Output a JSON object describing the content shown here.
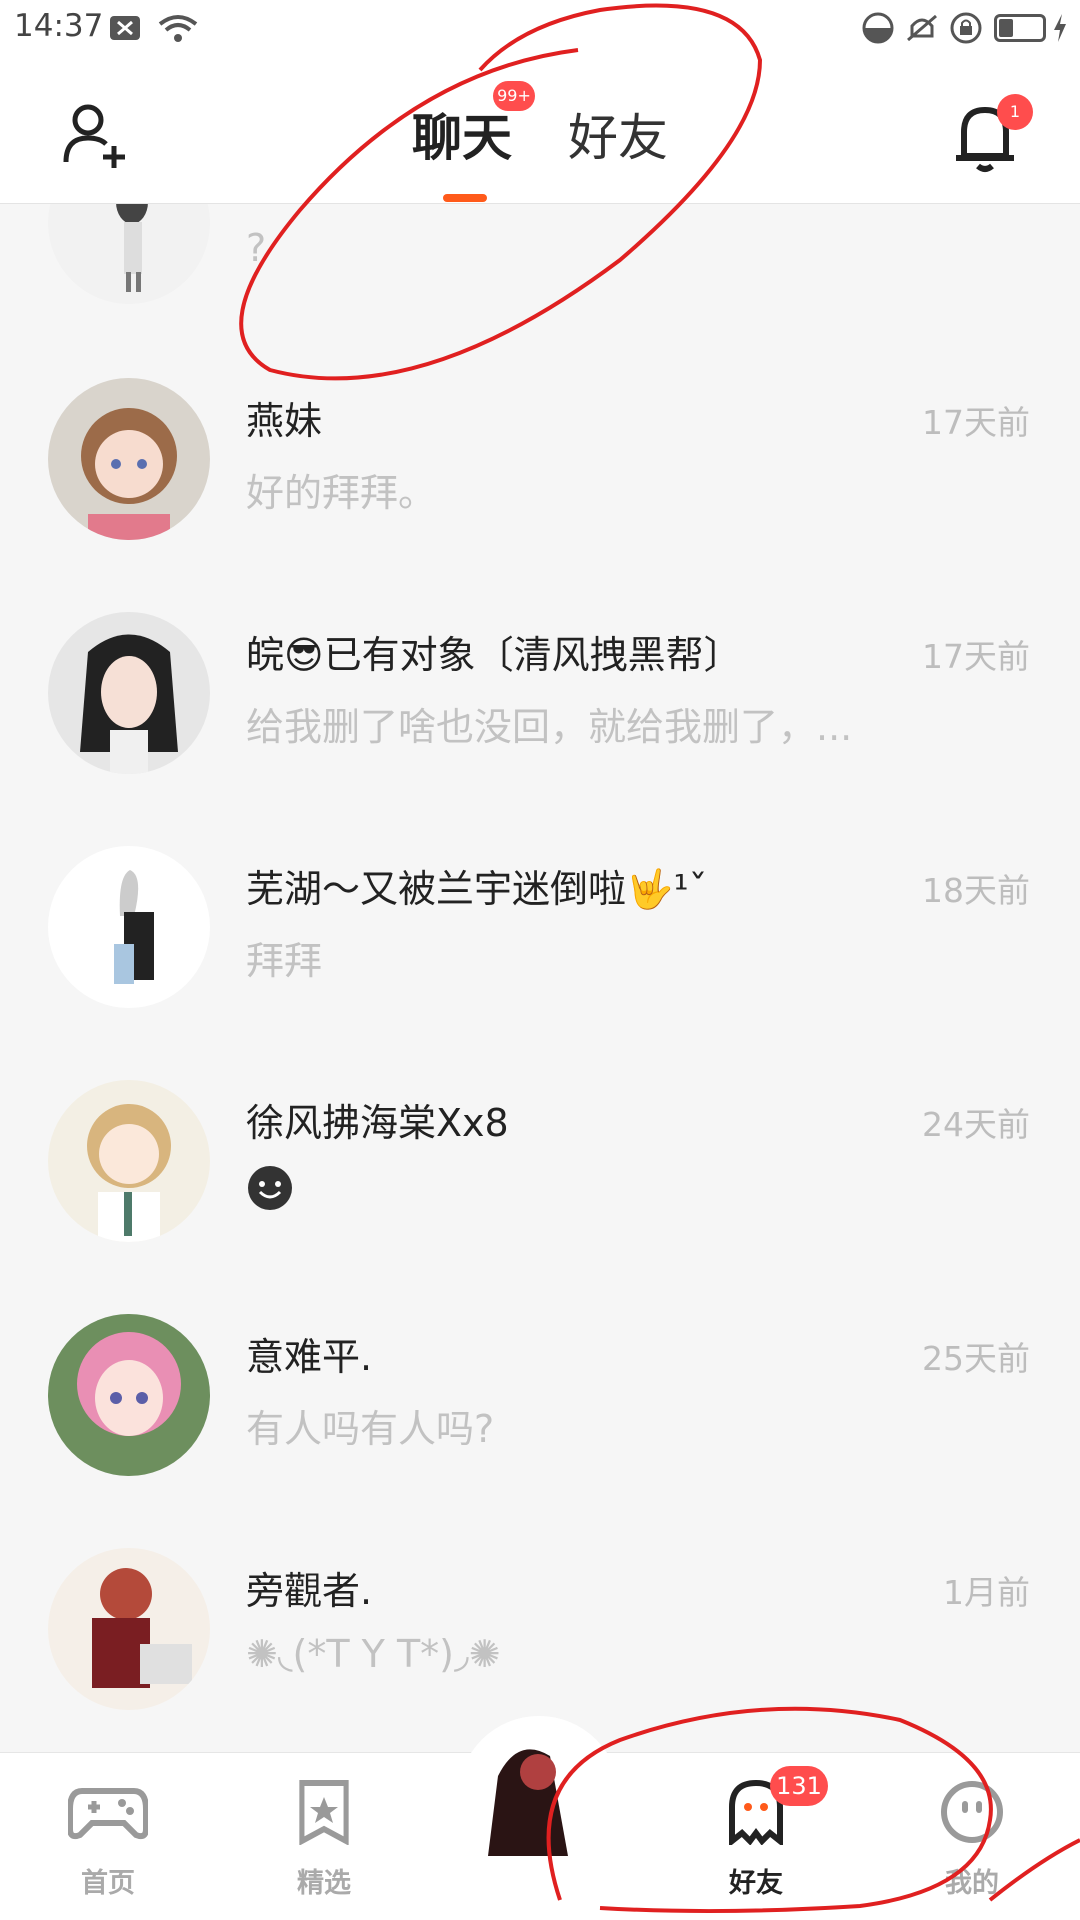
{
  "status_bar": {
    "time": "14:37"
  },
  "header": {
    "tabs": [
      "聊天",
      "好友"
    ],
    "chat_badge": "99+",
    "notification_badge": "1"
  },
  "chats": [
    {
      "name": "",
      "preview": "?",
      "time": ""
    },
    {
      "name": "燕妹",
      "preview": "好的拜拜。",
      "time": "17天前"
    },
    {
      "name": "皖😎已有对象〔清风拽黑帮〕",
      "preview": "给我删了啥也没回，就给我删了，...",
      "time": "17天前"
    },
    {
      "name": "芜湖～又被兰宇迷倒啦🤟¹ˇ",
      "preview": "拜拜",
      "time": "18天前"
    },
    {
      "name": "徐风拂海棠Xx8",
      "preview": "",
      "time": "24天前"
    },
    {
      "name": "意难平.",
      "preview": "有人吗有人吗?",
      "time": "25天前"
    },
    {
      "name": "旁觀者.",
      "preview": "✺◟(*T Y T*)◞✺",
      "time": "1月前"
    }
  ],
  "bottom_nav": {
    "items": [
      {
        "label": "首页",
        "icon": "gamepad-icon"
      },
      {
        "label": "精选",
        "icon": "star-bookmark-icon"
      },
      {
        "label": "好友",
        "icon": "ghost-icon"
      },
      {
        "label": "我的",
        "icon": "smile-face-icon"
      }
    ],
    "friends_badge": "131"
  },
  "colors": {
    "accent": "#ff5a1a",
    "badge": "#ff4d4d",
    "annotation": "#e02020"
  }
}
